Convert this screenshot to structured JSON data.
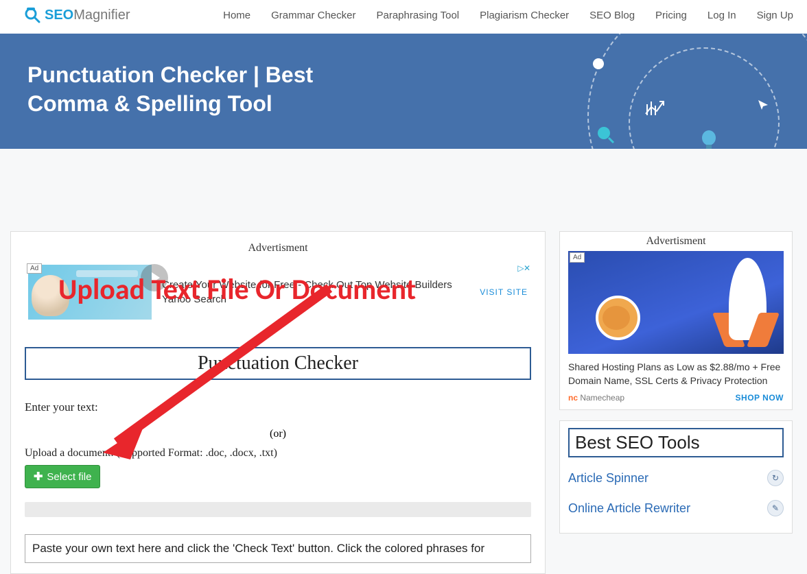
{
  "brand": {
    "seo": "SEO",
    "mag": "Magnifier"
  },
  "nav": {
    "home": "Home",
    "grammar": "Grammar Checker",
    "paraphrase": "Paraphrasing Tool",
    "plagiarism": "Plagiarism Checker",
    "blog": "SEO Blog",
    "pricing": "Pricing",
    "login": "Log In",
    "signup": "Sign Up"
  },
  "hero": {
    "title": "Punctuation Checker | Best Comma & Spelling Tool"
  },
  "main": {
    "ad_label": "Advertisment",
    "ad_badge": "Ad",
    "ad_closebox": "▷ ✕",
    "ad_line1": "Create Your Website for Free - Check Out Top Website Builders",
    "ad_line2": "Yahoo Search",
    "ad_visit": "VISIT SITE",
    "tool_title": "Punctuation Checker",
    "enter_text": "Enter your text:",
    "or": "(or)",
    "upload_label": "Upload a document: (Supported Format: .doc, .docx, .txt)",
    "select_file": "Select file",
    "paste_text": "Paste your own text here and click the 'Check Text' button. Click the colored phrases for"
  },
  "sidebar": {
    "ad_label": "Advertisment",
    "ad_badge": "Ad",
    "ad_closebox": "▷ ✕",
    "ad_text": "Shared Hosting Plans as Low as $2.88/mo + Free Domain Name, SSL Certs & Privacy Protection",
    "ad_brand": "Namecheap",
    "ad_cta": "SHOP NOW",
    "tools_title": "Best SEO Tools",
    "tool1": "Article Spinner",
    "tool2": "Online Article Rewriter"
  },
  "annotation": {
    "text": "Upload Text File Or Document"
  }
}
